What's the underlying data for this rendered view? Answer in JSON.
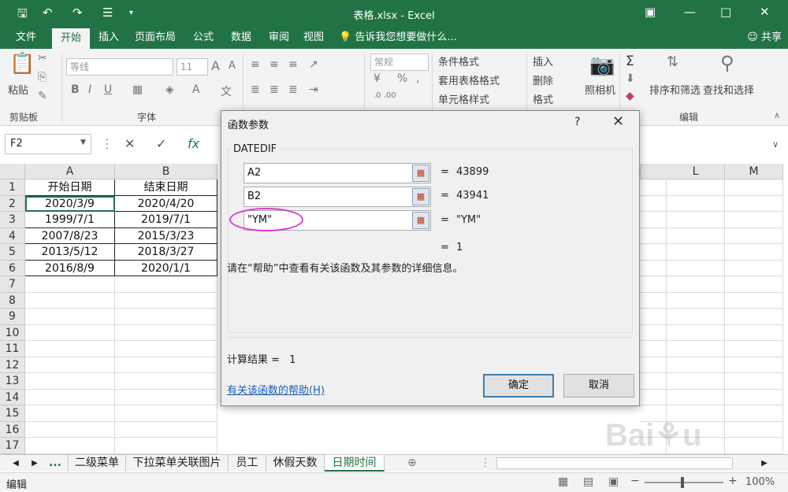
{
  "window": {
    "title": "表格.xlsx - Excel"
  },
  "ribbon": {
    "tabs": [
      "文件",
      "开始",
      "插入",
      "页面布局",
      "公式",
      "数据",
      "审阅",
      "视图"
    ],
    "tell_me": "告诉我您想要做什么...",
    "share": "共享",
    "font_name": "等线",
    "font_size": "11",
    "number_format": "常规",
    "paste_label": "粘贴",
    "group_clipboard": "剪贴板",
    "group_font": "字体",
    "group_edit": "编辑",
    "cond_format": "条件格式",
    "table_format": "套用表格格式",
    "cell_style": "单元格样式",
    "insert": "插入",
    "delete": "删除",
    "format": "格式",
    "camera": "照相机",
    "sort_filter": "排序和筛选",
    "find_select": "查找和选择",
    "fx": "fx"
  },
  "formula_bar": {
    "name_box": "F2"
  },
  "grid": {
    "columns": [
      "A",
      "B",
      "L",
      "M"
    ],
    "rows": [
      "1",
      "2",
      "3",
      "4",
      "5",
      "6",
      "7",
      "8",
      "9",
      "10",
      "11",
      "12",
      "13",
      "14",
      "15",
      "16",
      "17"
    ],
    "header_row": [
      "开始日期",
      "结束日期"
    ],
    "data": [
      [
        "2020/3/9",
        "2020/4/20"
      ],
      [
        "1999/7/1",
        "2019/7/1"
      ],
      [
        "2007/8/23",
        "2015/3/23"
      ],
      [
        "2013/5/12",
        "2018/3/27"
      ],
      [
        "2016/8/9",
        "2020/1/1"
      ]
    ]
  },
  "sheets": {
    "ellipsis": "...",
    "tabs": [
      "二级菜单",
      "下拉菜单关联图片",
      "员工",
      "休假天数",
      "日期时间"
    ],
    "active": "日期时间"
  },
  "status": {
    "mode": "编辑",
    "zoom": "100%"
  },
  "dialog": {
    "title": "函数参数",
    "help": "?",
    "function_name": "DATEDIF",
    "args": [
      {
        "input": "A2",
        "value": "43899"
      },
      {
        "input": "B2",
        "value": "43941"
      },
      {
        "input": "\"YM\"",
        "value": "\"YM\""
      }
    ],
    "result_preview": "1",
    "description": "请在“帮助”中查看有关该函数及其参数的详细信息。",
    "calc_label": "计算结果 =",
    "calc_value": "1",
    "help_link": "有关该函数的帮助(H)",
    "ok": "确定",
    "cancel": "取消"
  },
  "colors": {
    "accent": "#217346",
    "highlight": "#d63bd0"
  }
}
